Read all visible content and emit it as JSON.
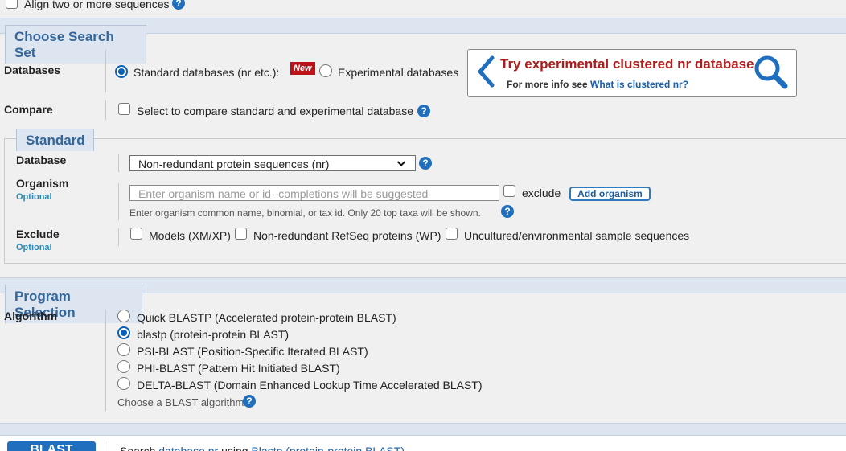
{
  "top": {
    "align_label": "Align two or more sequences"
  },
  "search_set": {
    "legend": "Choose Search Set",
    "databases_label": "Databases",
    "standard_radio_label": "Standard databases (nr etc.):",
    "new_badge": "New",
    "experimental_radio_label": "Experimental databases",
    "promo_title": "Try experimental clustered nr database",
    "promo_more_text": "For more info see",
    "promo_link": "What is clustered nr?",
    "compare_label": "Compare",
    "compare_checkbox_label": "Select to compare standard and experimental database"
  },
  "standard": {
    "legend": "Standard",
    "database_label": "Database",
    "database_value": "Non-redundant protein sequences (nr)",
    "organism_label": "Organism",
    "optional": "Optional",
    "organism_placeholder": "Enter organism name or id--completions will be suggested",
    "exclude_checkbox_label": "exclude",
    "add_organism_button": "Add organism",
    "organism_hint": "Enter organism common name, binomial, or tax id. Only 20 top taxa will be shown.",
    "exclude_label": "Exclude",
    "exclude_options": [
      "Models (XM/XP)",
      "Non-redundant RefSeq proteins (WP)",
      "Uncultured/environmental sample sequences"
    ]
  },
  "program": {
    "legend": "Program Selection",
    "algorithm_label": "Algorithm",
    "algorithms": [
      "Quick BLASTP (Accelerated protein-protein BLAST)",
      "blastp (protein-protein BLAST)",
      "PSI-BLAST (Position-Specific Iterated BLAST)",
      "PHI-BLAST (Pattern Hit Initiated BLAST)",
      "DELTA-BLAST (Domain Enhanced Lookup Time Accelerated BLAST)"
    ],
    "selected_algorithm": "blastp (protein-protein BLAST)",
    "choose_hint": "Choose a BLAST algorithm"
  },
  "footer": {
    "blast_button": "BLAST",
    "search_prefix": "Search",
    "search_db": "database nr",
    "search_using": "using",
    "search_program": "Blastp (protein-protein BLAST)"
  },
  "icons": {
    "help": "help-icon",
    "chevron": "chevron-left-icon",
    "search": "search-icon",
    "dropdown": "chevron-down-icon"
  },
  "colors": {
    "accent": "#1f6fbe",
    "legend_text": "#336699",
    "promo_title": "#b01c1c",
    "new_badge": "#b8141a",
    "band": "#dde5f1"
  }
}
